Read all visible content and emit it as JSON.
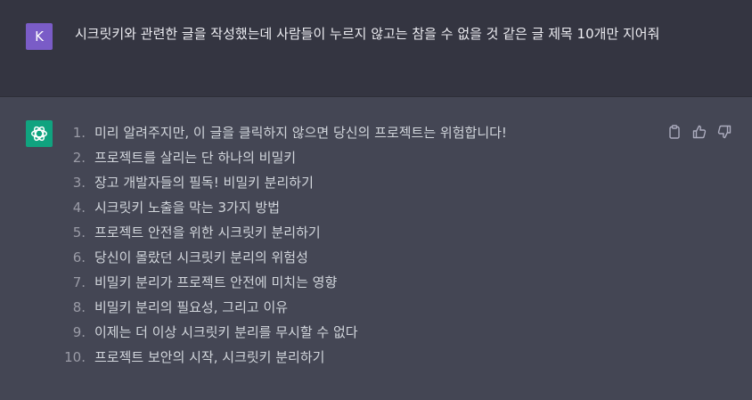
{
  "user": {
    "avatar_letter": "K",
    "message": "시크릿키와 관련한 글을 작성했는데 사람들이 누르지 않고는 참을 수 없을 것 같은 글 제목 10개만 지어줘"
  },
  "assistant": {
    "avatar_icon": "openai-logo-icon",
    "items": [
      {
        "num": "1.",
        "text": "미리 알려주지만, 이 글을 클릭하지 않으면 당신의 프로젝트는 위험합니다!"
      },
      {
        "num": "2.",
        "text": "프로젝트를 살리는 단 하나의 비밀키"
      },
      {
        "num": "3.",
        "text": "장고 개발자들의 필독! 비밀키 분리하기"
      },
      {
        "num": "4.",
        "text": "시크릿키 노출을 막는 3가지 방법"
      },
      {
        "num": "5.",
        "text": "프로젝트 안전을 위한 시크릿키 분리하기"
      },
      {
        "num": "6.",
        "text": "당신이 몰랐던 시크릿키 분리의 위험성"
      },
      {
        "num": "7.",
        "text": "비밀키 분리가 프로젝트 안전에 미치는 영향"
      },
      {
        "num": "8.",
        "text": "비밀키 분리의 필요성, 그리고 이유"
      },
      {
        "num": "9.",
        "text": "이제는 더 이상 시크릿키 분리를 무시할 수 없다"
      },
      {
        "num": "10.",
        "text": "프로젝트 보안의 시작, 시크릿키 분리하기"
      }
    ],
    "actions": [
      "clipboard-icon",
      "thumbs-up-icon",
      "thumbs-down-icon"
    ]
  },
  "colors": {
    "user_bg": "#343541",
    "assistant_bg": "#444654",
    "user_avatar": "#7a5cc7",
    "gpt_avatar": "#10a37f"
  }
}
